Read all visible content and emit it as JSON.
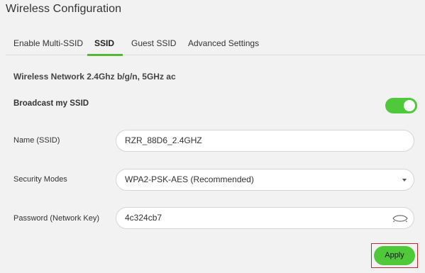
{
  "page": {
    "title": "Wireless Configuration"
  },
  "tabs": [
    {
      "label": "Enable Multi-SSID",
      "active": false
    },
    {
      "label": "SSID",
      "active": true
    },
    {
      "label": "Guest SSID",
      "active": false
    },
    {
      "label": "Advanced Settings",
      "active": false
    }
  ],
  "section": {
    "heading": "Wireless Network 2.4Ghz b/g/n, 5GHz ac"
  },
  "broadcast": {
    "label": "Broadcast my SSID",
    "enabled": true
  },
  "name_field": {
    "label": "Name (SSID)",
    "value": "RZR_88D6_2.4GHZ"
  },
  "security": {
    "label": "Security Modes",
    "selected": "WPA2-PSK-AES (Recommended)"
  },
  "password": {
    "label": "Password (Network Key)",
    "value": "4c324cb7"
  },
  "actions": {
    "apply_label": "Apply"
  },
  "colors": {
    "accent": "#4fc83a",
    "tab_underline": "#54b835",
    "highlight_outline": "#c1272d",
    "background": "#f2f2f2"
  },
  "icons": {
    "password_toggle": "eye-icon",
    "select_caret": "caret-down-icon"
  }
}
